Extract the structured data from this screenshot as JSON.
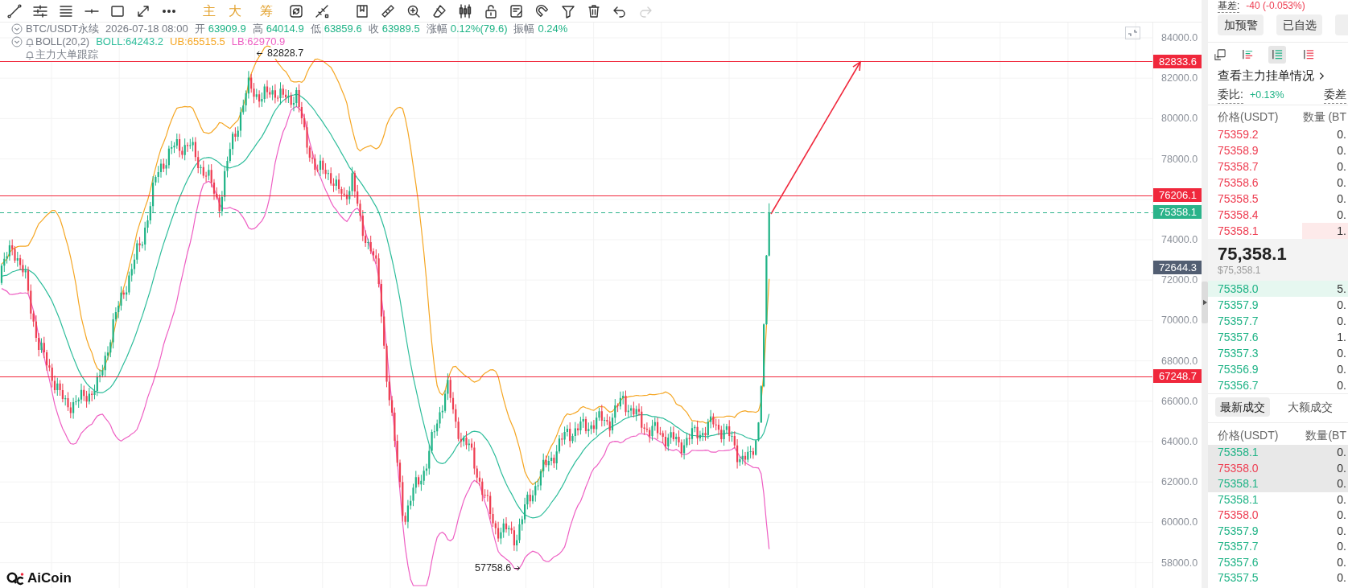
{
  "toolbar": {
    "indicator_buttons": [
      "主",
      "大",
      "筹"
    ],
    "undo": {
      "disabled": false
    },
    "redo": {
      "disabled": true
    }
  },
  "chart": {
    "legend": {
      "symbol": "BTC/USDT永续",
      "time": "2026-07-18 08:00",
      "stats": [
        {
          "label": "开",
          "value": "63909.9"
        },
        {
          "label": "高",
          "value": "64014.9"
        },
        {
          "label": "低",
          "value": "63859.6"
        },
        {
          "label": "收",
          "value": "63989.5"
        },
        {
          "label": "涨幅",
          "value": "0.12%(79.6)"
        },
        {
          "label": "振幅",
          "value": "0.24%"
        }
      ],
      "indicator": {
        "name": "BOLL(20,2)",
        "values": [
          {
            "text": "BOLL:64243.2",
            "color": "#2ebd9b"
          },
          {
            "text": "UB:65515.5",
            "color": "#f5a623"
          },
          {
            "text": "LB:62970.9",
            "color": "#ee5fc3"
          }
        ]
      },
      "tracker": "主力大单跟踪"
    },
    "y_axis": [
      "84000.0",
      "82000.0",
      "80000.0",
      "78000.0",
      "74000.0",
      "72000.0",
      "70000.0",
      "68000.0",
      "66000.0",
      "64000.0",
      "62000.0",
      "60000.0",
      "58000.0"
    ],
    "price_labels": [
      {
        "text": "82833.6",
        "kind": "line"
      },
      {
        "text": "76206.1",
        "kind": "line"
      },
      {
        "text": "75358.1",
        "kind": "last"
      },
      {
        "text": "72644.3",
        "kind": "marker"
      },
      {
        "text": "67248.7",
        "kind": "line"
      }
    ],
    "high_marker": "82828.7",
    "low_marker": "57758.6",
    "logo": "AiCoin"
  },
  "panel": {
    "basis": {
      "label": "基差:",
      "value": "-40 (-0.053%)"
    },
    "actions": [
      "加预警",
      "已自选"
    ],
    "book_views": [
      {
        "selected": false
      },
      {
        "selected": true
      },
      {
        "selected": false
      }
    ],
    "order_watch_link": "查看主力挂单情况",
    "ratio": {
      "label": "委比:",
      "value": "+0.13%"
    },
    "diff_label": "委差",
    "book_columns": [
      "价格(USDT)",
      "数量 (BT"
    ],
    "asks": [
      {
        "price": "75359.2",
        "qty": "0."
      },
      {
        "price": "75358.9",
        "qty": "0."
      },
      {
        "price": "75358.7",
        "qty": "0."
      },
      {
        "price": "75358.6",
        "qty": "0."
      },
      {
        "price": "75358.5",
        "qty": "0."
      },
      {
        "price": "75358.4",
        "qty": "0."
      },
      {
        "price": "75358.1",
        "qty": "1.",
        "level": 0.33
      }
    ],
    "mid": {
      "price": "75,358.1",
      "usd": "$75,358.1"
    },
    "bids": [
      {
        "price": "75358.0",
        "qty": "5.",
        "level": 1
      },
      {
        "price": "75357.9",
        "qty": "0."
      },
      {
        "price": "75357.7",
        "qty": "0."
      },
      {
        "price": "75357.6",
        "qty": "1."
      },
      {
        "price": "75357.3",
        "qty": "0."
      },
      {
        "price": "75356.9",
        "qty": "0."
      },
      {
        "price": "75356.7",
        "qty": "0."
      }
    ],
    "trade_tabs": [
      {
        "label": "最新成交",
        "selected": true
      },
      {
        "label": "大额成交",
        "selected": false
      }
    ],
    "trade_columns": [
      "价格(USDT)",
      "数量(BT"
    ],
    "trades": [
      {
        "price": "75358.1",
        "qty": "0.",
        "kind": "buy",
        "highlighted": true
      },
      {
        "price": "75358.0",
        "qty": "0.",
        "kind": "sell",
        "highlighted": true
      },
      {
        "price": "75358.1",
        "qty": "0.",
        "kind": "buy",
        "highlighted": true
      },
      {
        "price": "75358.1",
        "qty": "0.",
        "kind": "buy",
        "highlighted": false
      },
      {
        "price": "75358.0",
        "qty": "0.",
        "kind": "sell",
        "highlighted": false
      },
      {
        "price": "75357.9",
        "qty": "0.",
        "kind": "buy",
        "highlighted": false
      },
      {
        "price": "75357.7",
        "qty": "0.",
        "kind": "buy",
        "highlighted": false
      },
      {
        "price": "75357.6",
        "qty": "0.",
        "kind": "buy",
        "highlighted": false
      },
      {
        "price": "75357.5",
        "qty": "0.",
        "kind": "buy",
        "highlighted": false
      }
    ]
  }
}
